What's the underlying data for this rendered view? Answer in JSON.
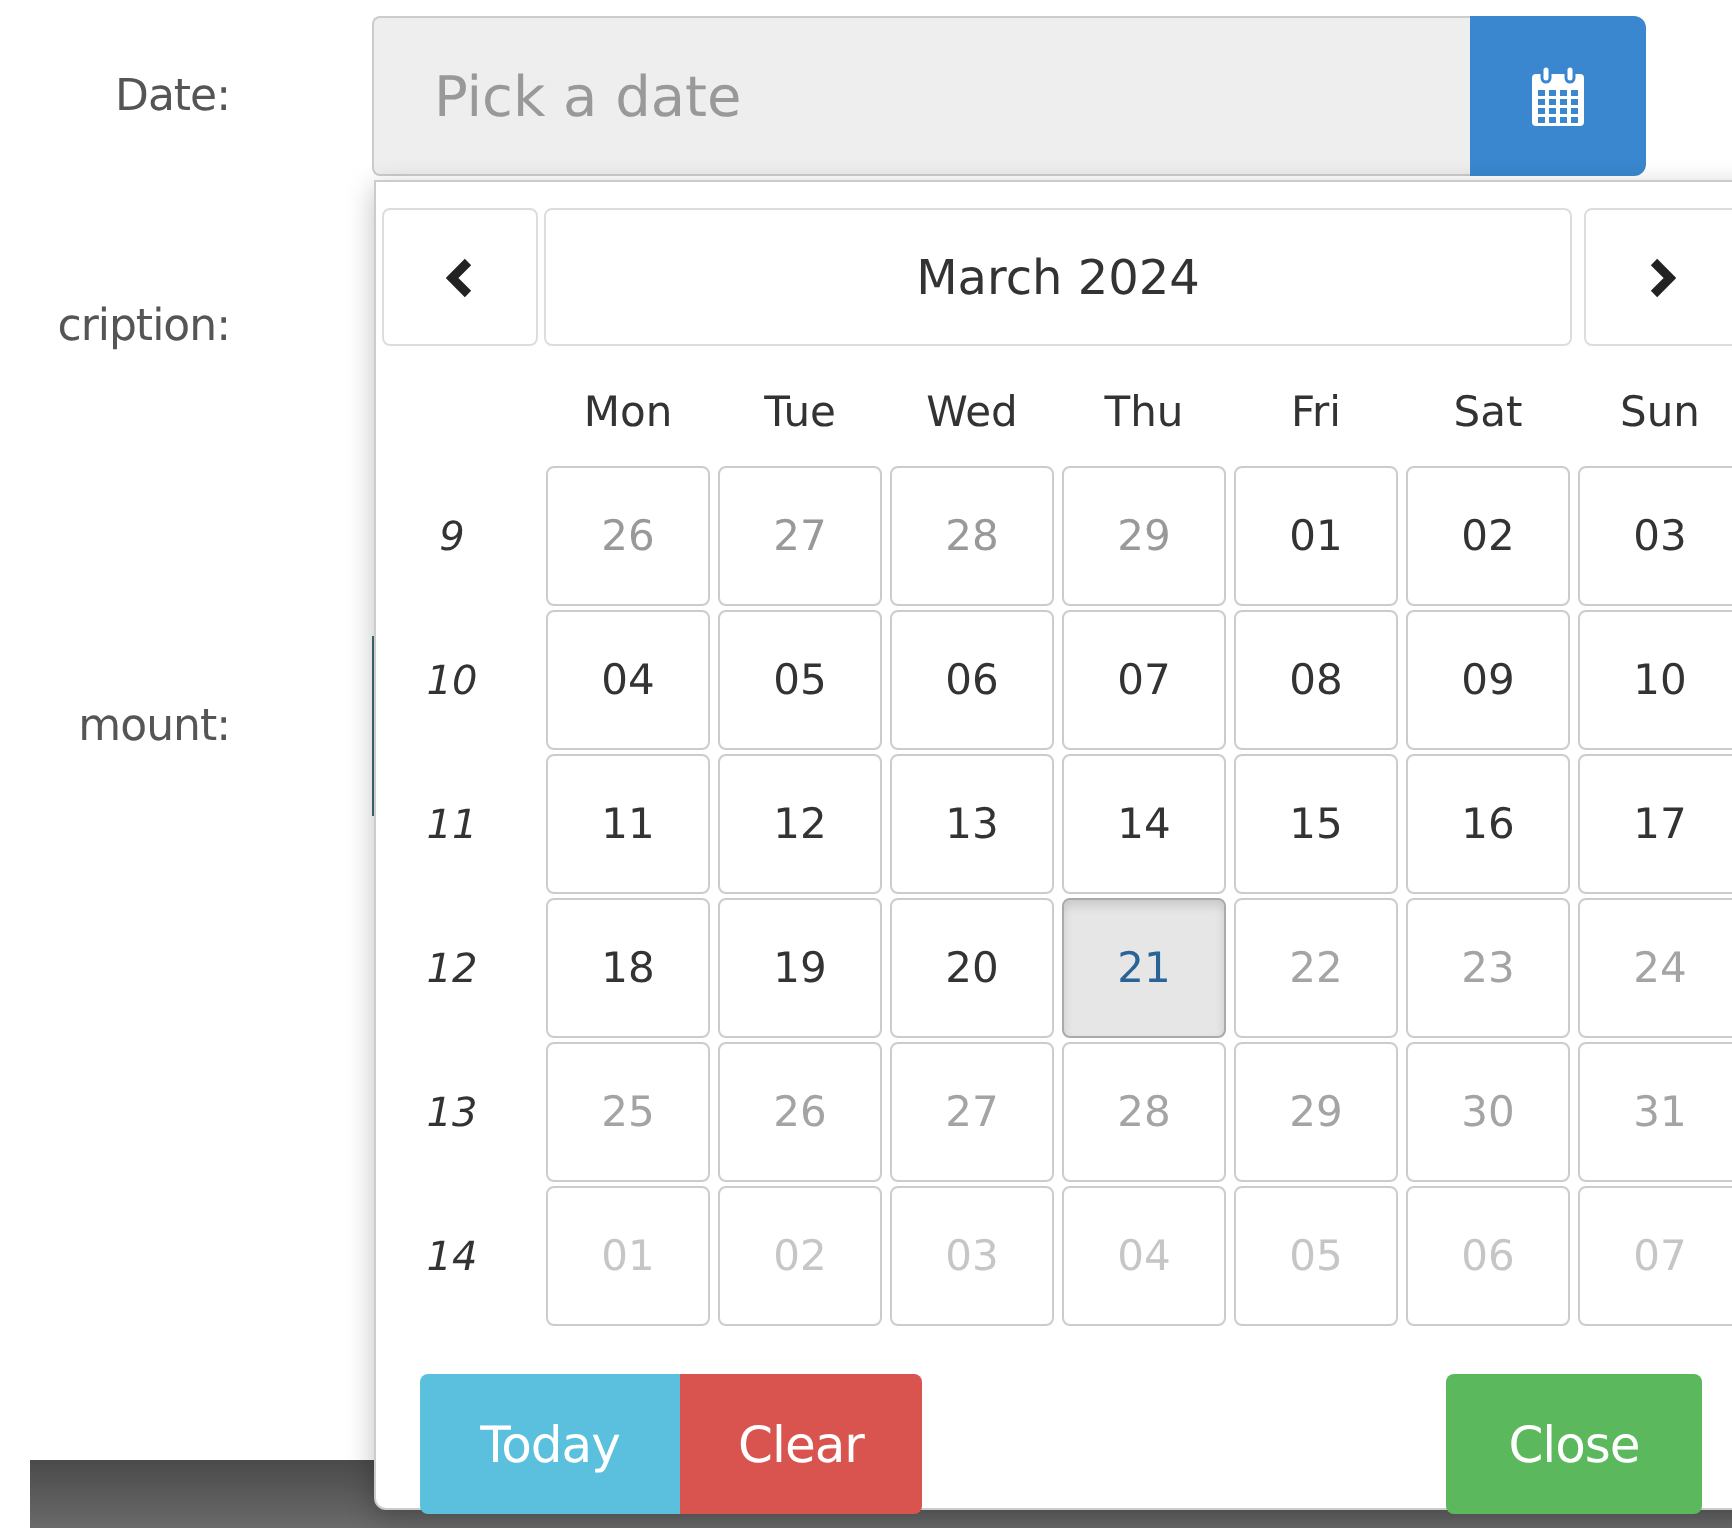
{
  "form": {
    "fields": [
      {
        "label": "Date:",
        "kind": "date"
      },
      {
        "label": "cription:",
        "kind": "text"
      },
      {
        "label": "mount:",
        "kind": "amount"
      }
    ],
    "date_field": {
      "placeholder": "Pick a date"
    }
  },
  "datepicker": {
    "title": "March 2024",
    "weekdays": [
      "Mon",
      "Tue",
      "Wed",
      "Thu",
      "Fri",
      "Sat",
      "Sun"
    ],
    "weeks": [
      {
        "number": "9",
        "days": [
          {
            "label": "26",
            "other_month": true,
            "disabled": false,
            "selected": false
          },
          {
            "label": "27",
            "other_month": true,
            "disabled": false,
            "selected": false
          },
          {
            "label": "28",
            "other_month": true,
            "disabled": false,
            "selected": false
          },
          {
            "label": "29",
            "other_month": true,
            "disabled": false,
            "selected": false
          },
          {
            "label": "01",
            "other_month": false,
            "disabled": false,
            "selected": false
          },
          {
            "label": "02",
            "other_month": false,
            "disabled": false,
            "selected": false
          },
          {
            "label": "03",
            "other_month": false,
            "disabled": false,
            "selected": false
          }
        ]
      },
      {
        "number": "10",
        "days": [
          {
            "label": "04",
            "other_month": false,
            "disabled": false,
            "selected": false
          },
          {
            "label": "05",
            "other_month": false,
            "disabled": false,
            "selected": false
          },
          {
            "label": "06",
            "other_month": false,
            "disabled": false,
            "selected": false
          },
          {
            "label": "07",
            "other_month": false,
            "disabled": false,
            "selected": false
          },
          {
            "label": "08",
            "other_month": false,
            "disabled": false,
            "selected": false
          },
          {
            "label": "09",
            "other_month": false,
            "disabled": false,
            "selected": false
          },
          {
            "label": "10",
            "other_month": false,
            "disabled": false,
            "selected": false
          }
        ]
      },
      {
        "number": "11",
        "days": [
          {
            "label": "11",
            "other_month": false,
            "disabled": false,
            "selected": false
          },
          {
            "label": "12",
            "other_month": false,
            "disabled": false,
            "selected": false
          },
          {
            "label": "13",
            "other_month": false,
            "disabled": false,
            "selected": false
          },
          {
            "label": "14",
            "other_month": false,
            "disabled": false,
            "selected": false
          },
          {
            "label": "15",
            "other_month": false,
            "disabled": false,
            "selected": false
          },
          {
            "label": "16",
            "other_month": false,
            "disabled": false,
            "selected": false
          },
          {
            "label": "17",
            "other_month": false,
            "disabled": false,
            "selected": false
          }
        ]
      },
      {
        "number": "12",
        "days": [
          {
            "label": "18",
            "other_month": false,
            "disabled": false,
            "selected": false
          },
          {
            "label": "19",
            "other_month": false,
            "disabled": false,
            "selected": false
          },
          {
            "label": "20",
            "other_month": false,
            "disabled": false,
            "selected": false
          },
          {
            "label": "21",
            "other_month": false,
            "disabled": false,
            "selected": true
          },
          {
            "label": "22",
            "other_month": false,
            "disabled": true,
            "selected": false
          },
          {
            "label": "23",
            "other_month": false,
            "disabled": true,
            "selected": false
          },
          {
            "label": "24",
            "other_month": false,
            "disabled": true,
            "selected": false
          }
        ]
      },
      {
        "number": "13",
        "days": [
          {
            "label": "25",
            "other_month": false,
            "disabled": true,
            "selected": false
          },
          {
            "label": "26",
            "other_month": false,
            "disabled": true,
            "selected": false
          },
          {
            "label": "27",
            "other_month": false,
            "disabled": true,
            "selected": false
          },
          {
            "label": "28",
            "other_month": false,
            "disabled": true,
            "selected": false
          },
          {
            "label": "29",
            "other_month": false,
            "disabled": true,
            "selected": false
          },
          {
            "label": "30",
            "other_month": false,
            "disabled": true,
            "selected": false
          },
          {
            "label": "31",
            "other_month": false,
            "disabled": true,
            "selected": false
          }
        ]
      },
      {
        "number": "14",
        "days": [
          {
            "label": "01",
            "other_month": true,
            "disabled": true,
            "selected": false
          },
          {
            "label": "02",
            "other_month": true,
            "disabled": true,
            "selected": false
          },
          {
            "label": "03",
            "other_month": true,
            "disabled": true,
            "selected": false
          },
          {
            "label": "04",
            "other_month": true,
            "disabled": true,
            "selected": false
          },
          {
            "label": "05",
            "other_month": true,
            "disabled": true,
            "selected": false
          },
          {
            "label": "06",
            "other_month": true,
            "disabled": true,
            "selected": false
          },
          {
            "label": "07",
            "other_month": true,
            "disabled": true,
            "selected": false
          }
        ]
      }
    ],
    "buttons": [
      {
        "label": "Today",
        "kind": "today"
      },
      {
        "label": "Clear",
        "kind": "clear"
      },
      {
        "label": "Close",
        "kind": "close"
      }
    ]
  }
}
